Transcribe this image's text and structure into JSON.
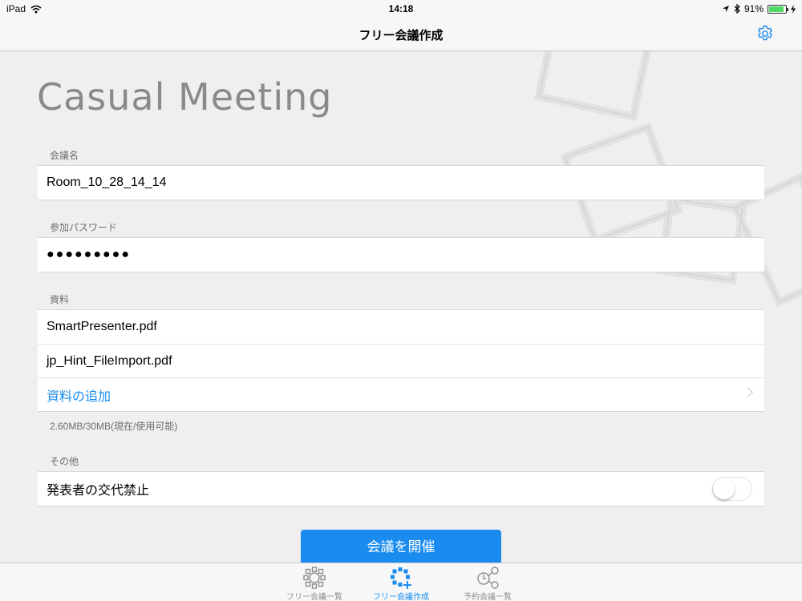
{
  "status_bar": {
    "device": "iPad",
    "time": "14:18",
    "battery": "91%",
    "battery_level": 0.91
  },
  "nav": {
    "title": "フリー会議作成",
    "settings_icon": "gear-icon"
  },
  "app_logo": "Casual Meeting",
  "meeting_name": {
    "label": "会議名",
    "value": "Room_10_28_14_14"
  },
  "password": {
    "label": "参加パスワード",
    "masked": "●●●●●●●●●"
  },
  "materials": {
    "label": "資料",
    "files": [
      "SmartPresenter.pdf",
      "jp_Hint_FileImport.pdf"
    ],
    "add_label": "資料の追加",
    "usage": "2.60MB/30MB(現在/使用可能)"
  },
  "other": {
    "label": "その他",
    "presenter_lock_label": "発表者の交代禁止",
    "presenter_lock_on": false
  },
  "start_button": "会議を開催",
  "colors": {
    "accent": "#1a8cf0",
    "background": "#efefef"
  },
  "tabs": [
    {
      "label": "フリー会議一覧",
      "icon": "meeting-list-icon",
      "active": false
    },
    {
      "label": "フリー会議作成",
      "icon": "create-meeting-icon",
      "active": true
    },
    {
      "label": "予約会議一覧",
      "icon": "scheduled-meeting-icon",
      "active": false
    }
  ]
}
